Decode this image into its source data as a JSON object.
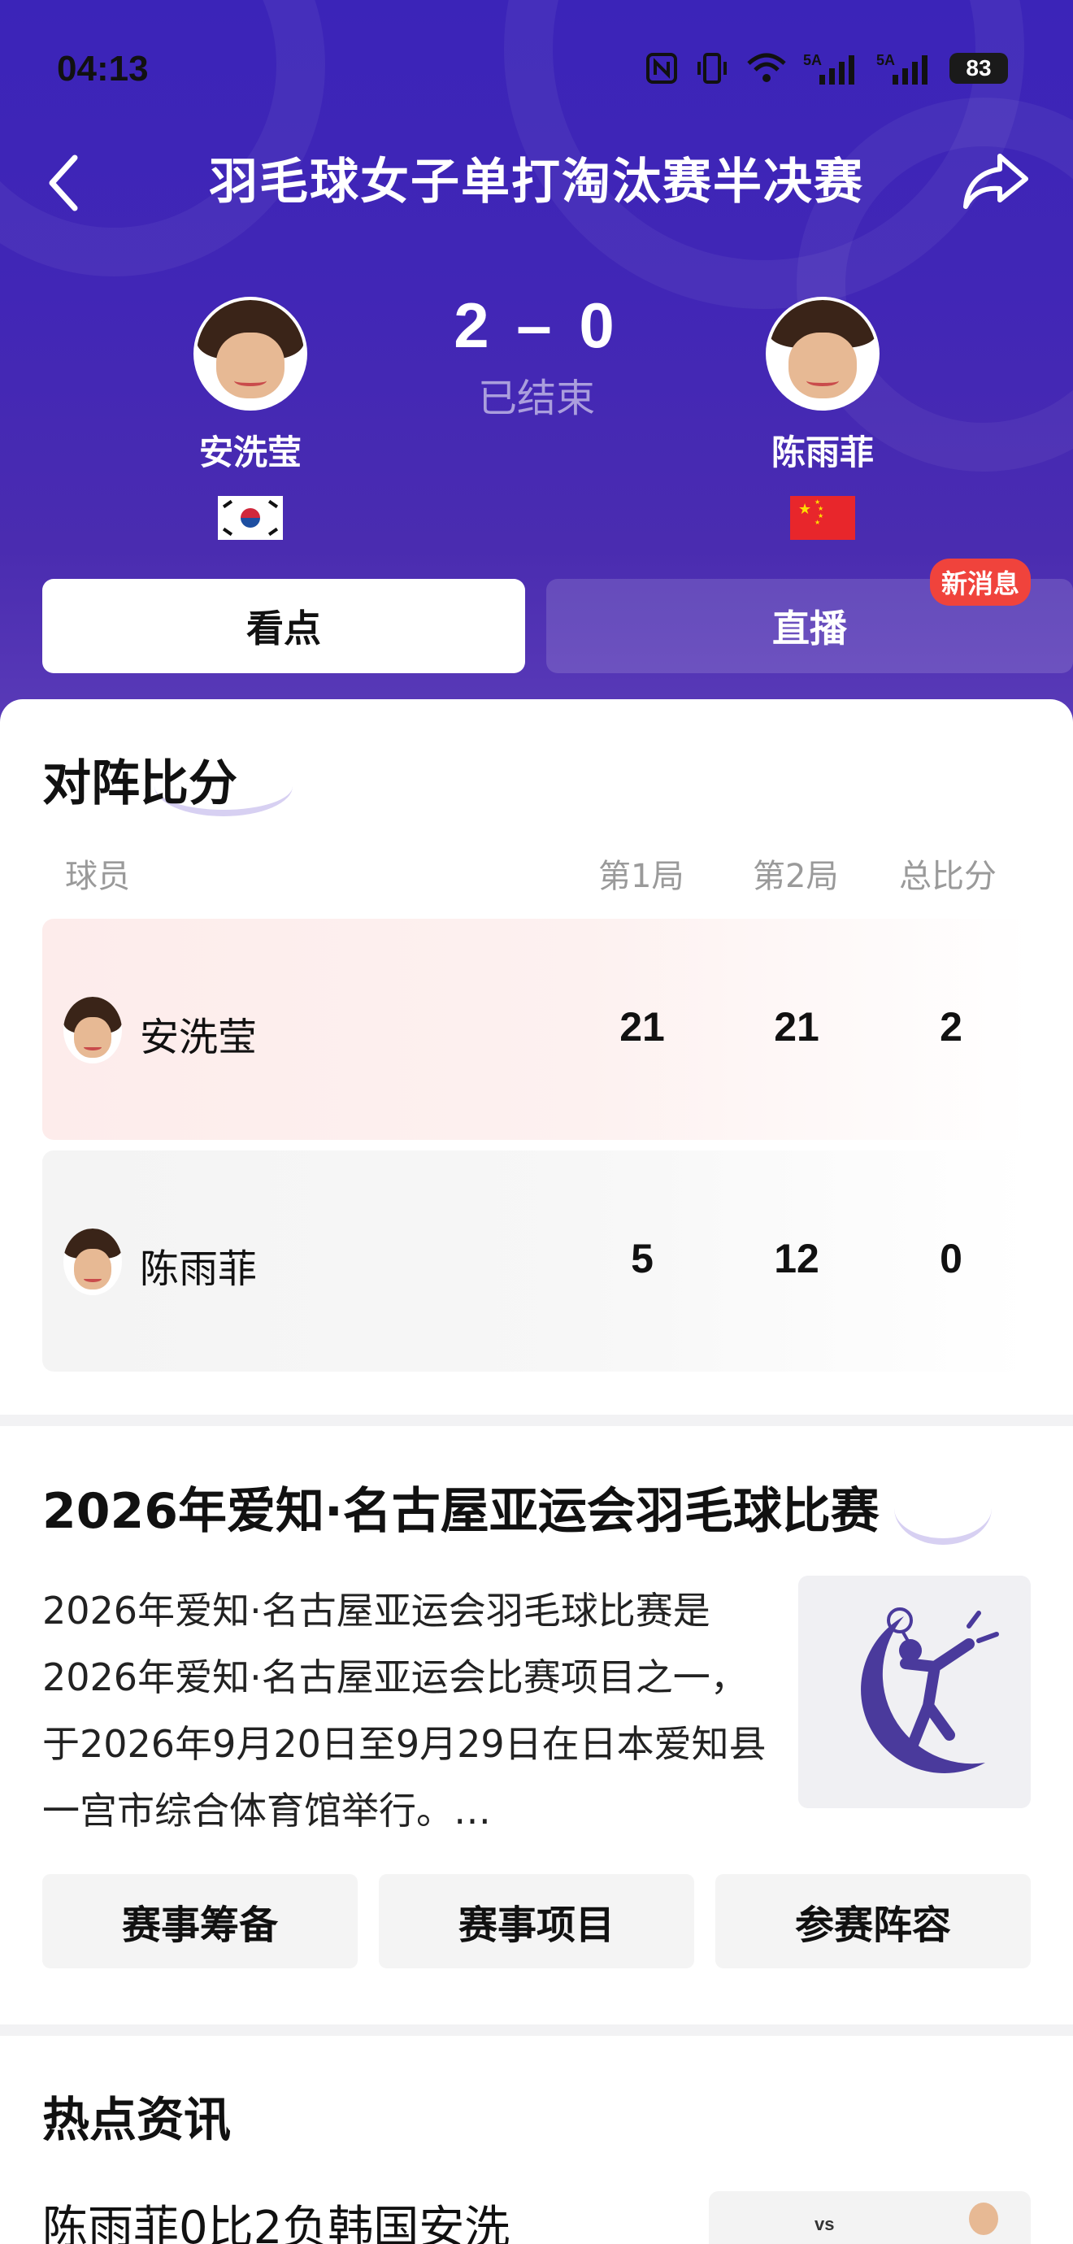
{
  "status_bar": {
    "time": "04:13",
    "signal1": "5A",
    "signal2": "5A",
    "battery": "83"
  },
  "header": {
    "title": "羽毛球女子单打淘汰赛半决赛",
    "score": "2 – 0",
    "match_status": "已结束",
    "player_left": {
      "name": "安洗莹",
      "flag": "korea-flag"
    },
    "player_right": {
      "name": "陈雨菲",
      "flag": "china-flag"
    }
  },
  "tabs": {
    "highlights": "看点",
    "live": "直播",
    "new_badge": "新消息"
  },
  "scoreboard": {
    "title": "对阵比分",
    "columns": [
      "球员",
      "第1局",
      "第2局",
      "总比分"
    ],
    "rows": [
      {
        "player": "安洗莹",
        "game1": "21",
        "game2": "21",
        "total": "2"
      },
      {
        "player": "陈雨菲",
        "game1": "5",
        "game2": "12",
        "total": "0"
      }
    ]
  },
  "event": {
    "title": "2026年爱知·名古屋亚运会羽毛球比赛",
    "description": "2026年爱知·名古屋亚运会羽毛球比赛是2026年爱知·名古屋亚运会比赛项目之一，于2026年9月20日至9月29日在日本爱知县一宫市综合体育馆举行。…",
    "buttons": [
      "赛事筹备",
      "赛事项目",
      "参赛阵容"
    ]
  },
  "news": {
    "title": "热点资讯",
    "first_item_title": "陈雨菲0比2负韩国安洗",
    "thumb_text": "vs"
  },
  "colors": {
    "header_purple": "#3b24b8",
    "badge_red": "#f0433c",
    "win_row": "#fdeceb"
  }
}
